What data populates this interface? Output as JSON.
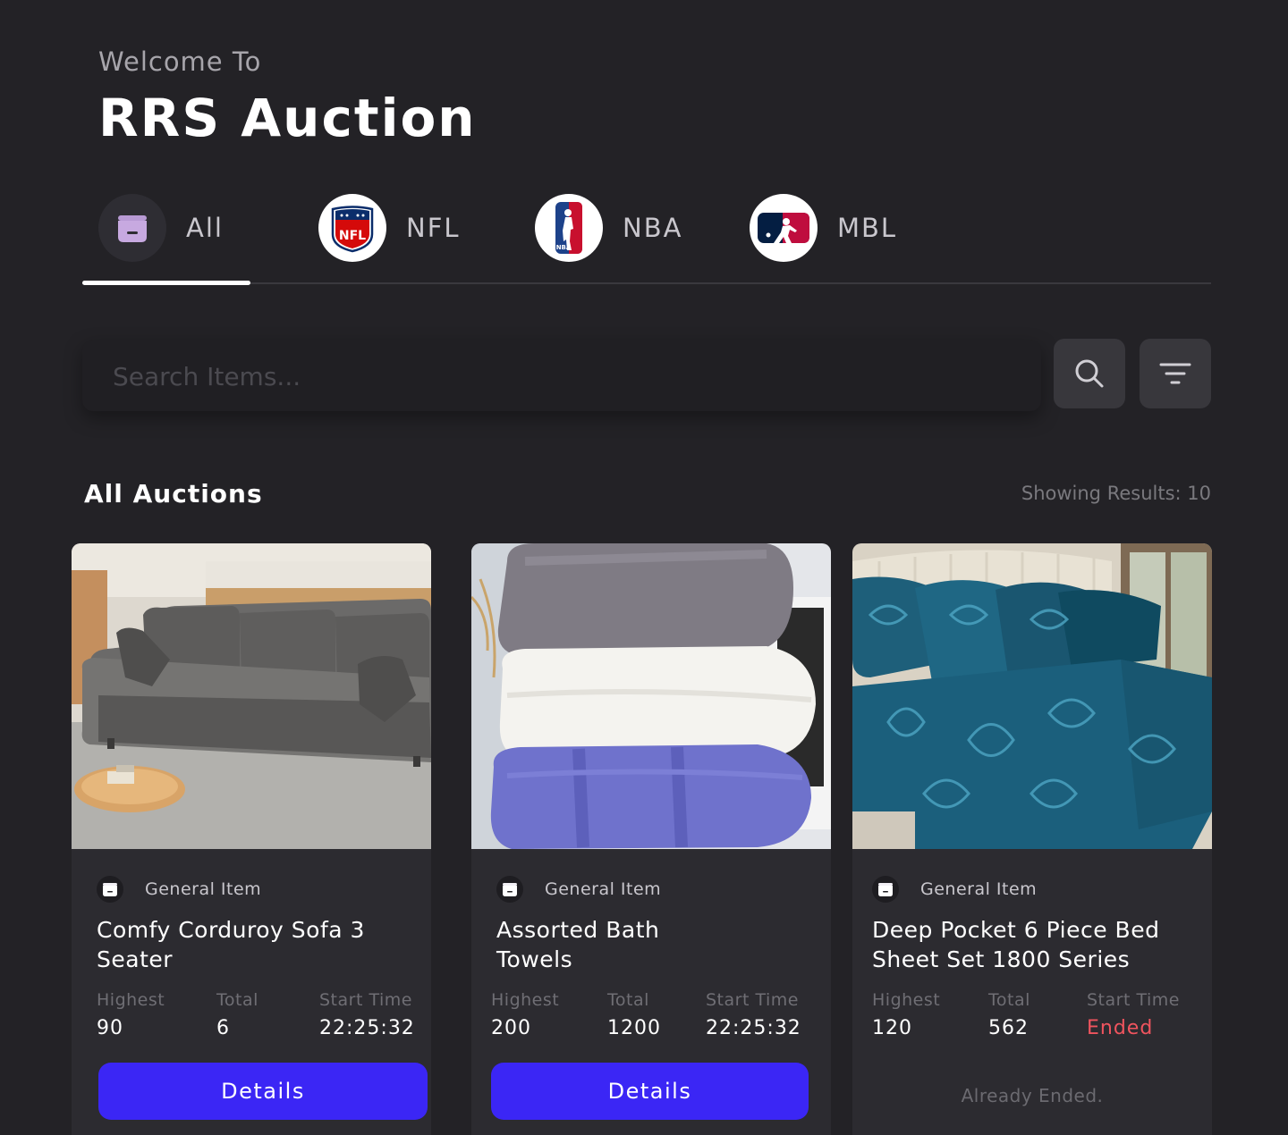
{
  "header": {
    "welcome": "Welcome To",
    "title": "RRS Auction"
  },
  "tabs": [
    {
      "label": "All",
      "icon": "general-item-icon",
      "active": true
    },
    {
      "label": "NFL",
      "icon": "nfl-logo-icon",
      "active": false
    },
    {
      "label": "NBA",
      "icon": "nba-logo-icon",
      "active": false
    },
    {
      "label": "MBL",
      "icon": "mlb-logo-icon",
      "active": false
    }
  ],
  "search": {
    "placeholder": "Search Items...",
    "value": ""
  },
  "section": {
    "title": "All Auctions",
    "results": "Showing Results: 10"
  },
  "stat_labels": {
    "highest": "Highest",
    "total": "Total",
    "start_time": "Start Time"
  },
  "cards": [
    {
      "category": "General Item",
      "name": "Comfy Corduroy Sofa 3 Seater",
      "highest": "90",
      "total": "6",
      "start_time": "22:25:32",
      "action": "Details",
      "image": "gray-corduroy-sofa"
    },
    {
      "category": "General Item",
      "name": "Assorted Bath Towels",
      "highest": "200",
      "total": "1200",
      "start_time": "22:25:32",
      "action": "Details",
      "image": "folded-towels-stack"
    },
    {
      "category": "General Item",
      "name": "Deep Pocket 6 Piece Bed Sheet Set 1800 Series",
      "highest": "120",
      "total": "562",
      "start_time": "Ended",
      "action": "Already Ended.",
      "image": "blue-paisley-bedsheet"
    }
  ],
  "colors": {
    "background": "#232226",
    "card": "#2c2b30",
    "primary": "#3b26f5",
    "ended": "#f0545e",
    "muted": "#6f6e74"
  }
}
